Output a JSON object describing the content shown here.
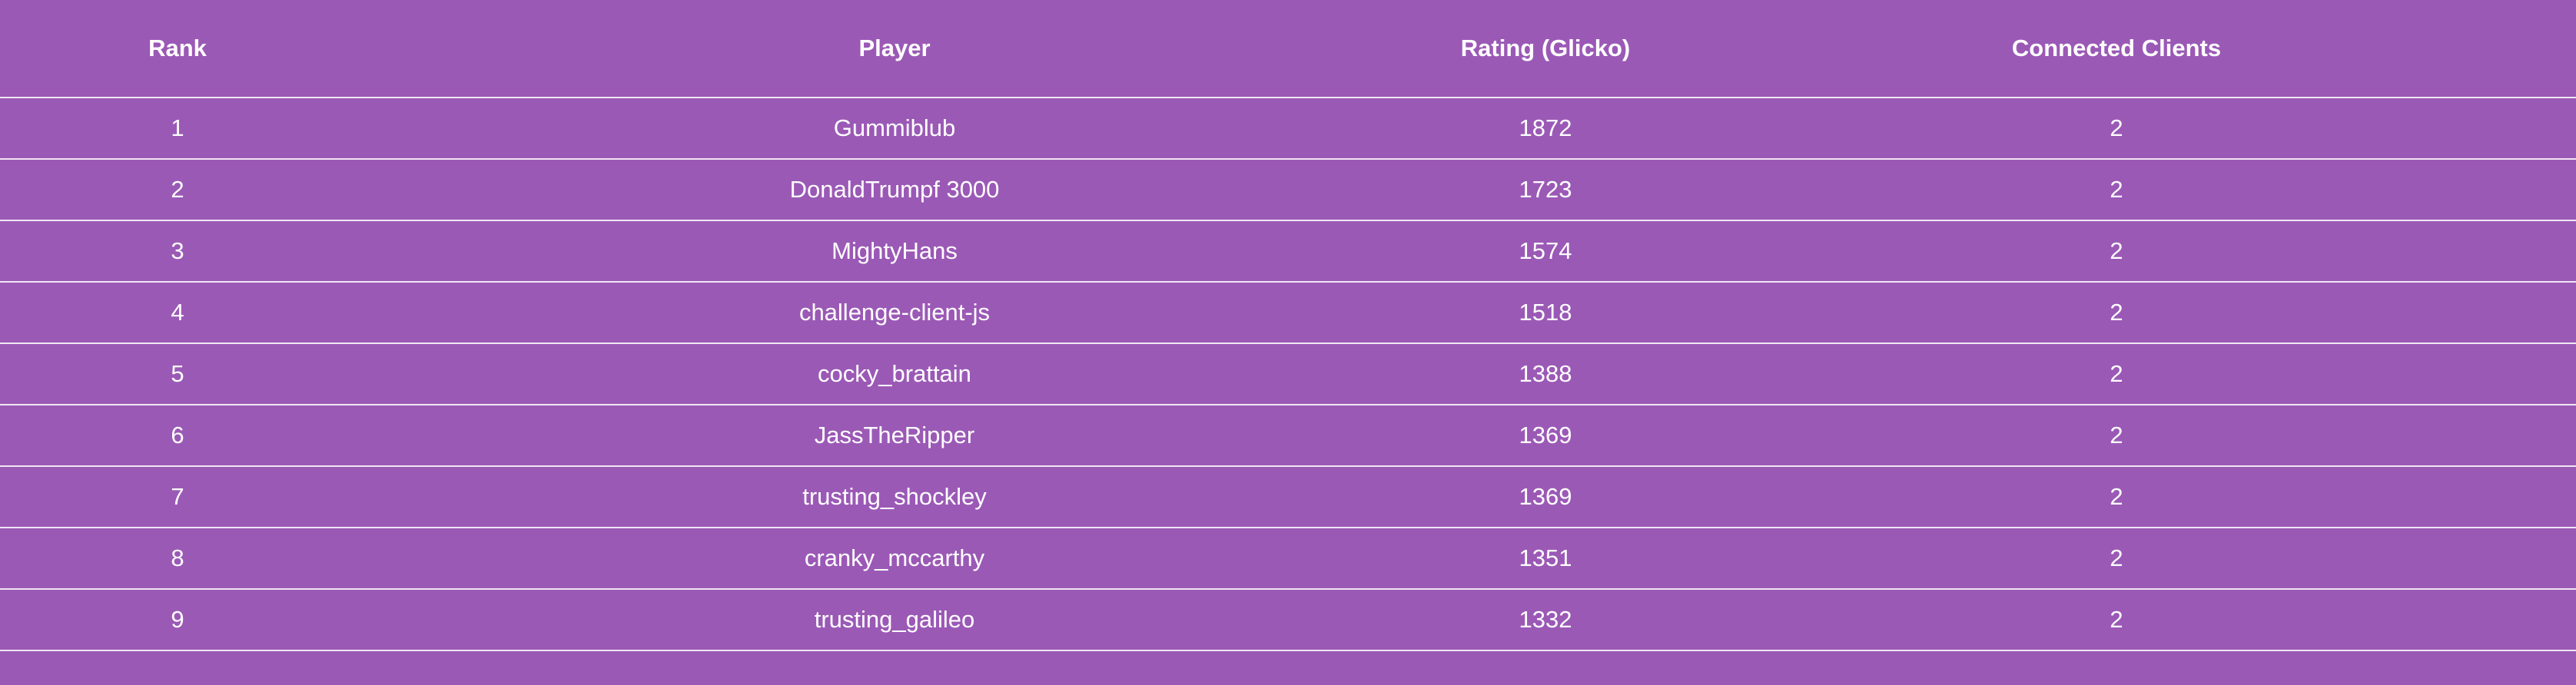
{
  "leaderboard": {
    "headers": {
      "rank": "Rank",
      "player": "Player",
      "rating": "Rating (Glicko)",
      "clients": "Connected Clients"
    },
    "rows": [
      {
        "rank": "1",
        "player": "Gummiblub",
        "rating": "1872",
        "clients": "2"
      },
      {
        "rank": "2",
        "player": "DonaldTrumpf 3000",
        "rating": "1723",
        "clients": "2"
      },
      {
        "rank": "3",
        "player": "MightyHans",
        "rating": "1574",
        "clients": "2"
      },
      {
        "rank": "4",
        "player": "challenge-client-js",
        "rating": "1518",
        "clients": "2"
      },
      {
        "rank": "5",
        "player": "cocky_brattain",
        "rating": "1388",
        "clients": "2"
      },
      {
        "rank": "6",
        "player": "JassTheRipper",
        "rating": "1369",
        "clients": "2"
      },
      {
        "rank": "7",
        "player": "trusting_shockley",
        "rating": "1369",
        "clients": "2"
      },
      {
        "rank": "8",
        "player": "cranky_mccarthy",
        "rating": "1351",
        "clients": "2"
      },
      {
        "rank": "9",
        "player": "trusting_galileo",
        "rating": "1332",
        "clients": "2"
      }
    ]
  },
  "colors": {
    "background": "#9b59b6",
    "text": "#ffffff",
    "divider": "#ffffff"
  }
}
